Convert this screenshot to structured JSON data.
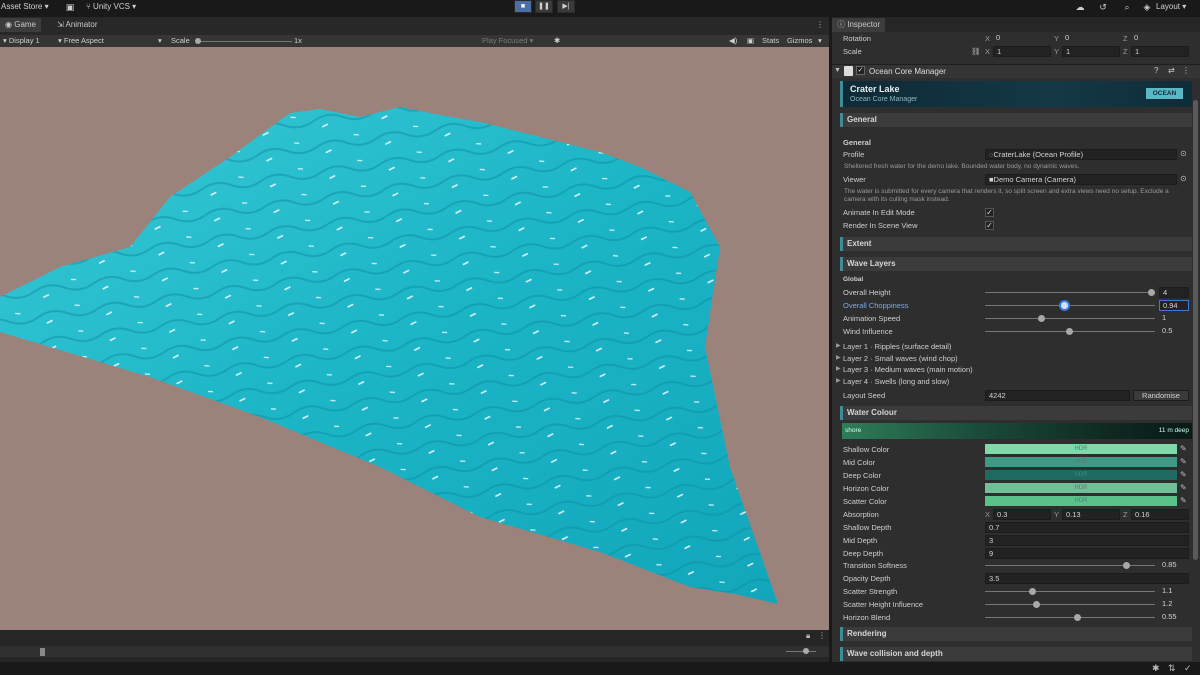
{
  "topbar": {
    "asset_store": "Asset Store",
    "vcs": "Unity VCS",
    "layout": "Layout"
  },
  "game": {
    "tabs": [
      "Game",
      "Animator"
    ],
    "display": "Display 1",
    "aspect": "Free Aspect",
    "scale_label": "Scale",
    "scale_value": "1x",
    "play_focused": "Play Focused",
    "stats": "Stats",
    "gizmos": "Gizmos"
  },
  "inspector": {
    "tab": "Inspector",
    "transform": {
      "rotation_label": "Rotation",
      "rotation": {
        "x": "0",
        "y": "0",
        "z": "0"
      },
      "scale_label": "Scale",
      "scale": {
        "x": "1",
        "y": "1",
        "z": "1"
      }
    },
    "component_title": "Ocean Core Manager",
    "banner": {
      "title": "Crater Lake",
      "subtitle": "Ocean Core Manager",
      "badge": "OCEAN"
    },
    "sections": {
      "general": "General",
      "extent": "Extent",
      "wave_layers": "Wave Layers",
      "water_colour": "Water Colour",
      "rendering": "Rendering",
      "wave_collision": "Wave collision and depth"
    },
    "general": {
      "header": "General",
      "profile_label": "Profile",
      "profile_value": "CraterLake (Ocean Profile)",
      "profile_help": "Sheltered fresh water for the demo lake. Bounded water body, no dynamic waves.",
      "viewer_label": "Viewer",
      "viewer_value": "Demo Camera (Camera)",
      "viewer_help": "The water is submitted for every camera that renders it, so split screen and extra views need no setup. Exclude a camera with its culling mask instead.",
      "animate_label": "Animate In Edit Mode",
      "render_scene_label": "Render In Scene View"
    },
    "waves": {
      "global": "Global",
      "overall_height_label": "Overall Height",
      "overall_height": "4",
      "overall_choppiness_label": "Overall Choppiness",
      "overall_choppiness": "0.94",
      "animation_speed_label": "Animation Speed",
      "animation_speed": "1",
      "wind_influence_label": "Wind Influence",
      "wind_influence": "0.5",
      "layers": [
        "Layer 1 · Ripples (surface detail)",
        "Layer 2 · Small waves (wind chop)",
        "Layer 3 · Medium waves (main motion)",
        "Layer 4 · Swells (long and slow)"
      ],
      "layout_seed_label": "Layout Seed",
      "layout_seed": "4242",
      "randomise": "Randomise"
    },
    "water_colour": {
      "gradient_left": "shore",
      "gradient_right": "11 m deep",
      "hdr": "HDR",
      "colors": [
        {
          "label": "Shallow Color",
          "hex": "#7fd9a9"
        },
        {
          "label": "Mid Color",
          "hex": "#3f9a85"
        },
        {
          "label": "Deep Color",
          "hex": "#1f6a60"
        },
        {
          "label": "Horizon Color",
          "hex": "#6fbf98"
        },
        {
          "label": "Scatter Color",
          "hex": "#59c28a"
        }
      ],
      "absorption_label": "Absorption",
      "absorption": {
        "x": "0.3",
        "y": "0.13",
        "z": "0.16"
      },
      "shallow_depth_label": "Shallow Depth",
      "shallow_depth": "0.7",
      "mid_depth_label": "Mid Depth",
      "mid_depth": "3",
      "deep_depth_label": "Deep Depth",
      "deep_depth": "9",
      "transition_softness_label": "Transition Softness",
      "transition_softness": "0.85",
      "opacity_depth_label": "Opacity Depth",
      "opacity_depth": "3.5",
      "scatter_strength_label": "Scatter Strength",
      "scatter_strength": "1.1",
      "scatter_height_label": "Scatter Height Influence",
      "scatter_height": "1.2",
      "horizon_blend_label": "Horizon Blend",
      "horizon_blend": "0.55"
    }
  },
  "colors": {
    "accent": "#3e8c97",
    "water": "#1fb8c8",
    "viewport_bg": "#9b827b",
    "play_active": "#4a6fa5"
  }
}
